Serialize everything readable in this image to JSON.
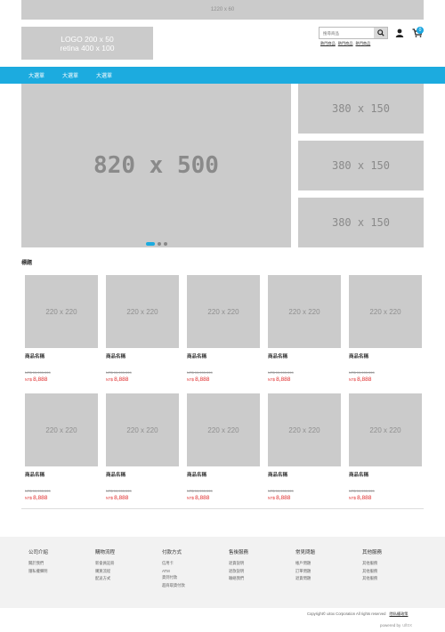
{
  "top_banner": "1220 x 60",
  "logo": {
    "line1": "LOGO 200 x 50",
    "line2": "retina 400 x 100"
  },
  "search": {
    "placeholder": "搜尋商品"
  },
  "hot_links": [
    "熱門商品",
    "熱門商品",
    "熱門商品"
  ],
  "cart_count": "0",
  "nav": [
    "大選單",
    "大選單",
    "大選單"
  ],
  "hero": "820 x 500",
  "side_banners": [
    "380 x 150",
    "380 x 150",
    "380 x 150"
  ],
  "section_title": "標題",
  "product_image_label": "220 x 220",
  "products": [
    {
      "name": "商品名稱",
      "original_price": "NT$ 99,999,999",
      "currency": "NT$",
      "price": "8,888"
    },
    {
      "name": "商品名稱",
      "original_price": "NT$ 99,999,999",
      "currency": "NT$",
      "price": "8,888"
    },
    {
      "name": "商品名稱",
      "original_price": "NT$ 99,999,999",
      "currency": "NT$",
      "price": "8,888"
    },
    {
      "name": "商品名稱",
      "original_price": "NT$ 99,999,999",
      "currency": "NT$",
      "price": "8,888"
    },
    {
      "name": "商品名稱",
      "original_price": "NT$ 99,999,999",
      "currency": "NT$",
      "price": "8,888"
    },
    {
      "name": "商品名稱",
      "original_price": "NT$ 99,999,999",
      "currency": "NT$",
      "price": "8,888"
    },
    {
      "name": "商品名稱",
      "original_price": "NT$ 99,999,999",
      "currency": "NT$",
      "price": "8,888"
    },
    {
      "name": "商品名稱",
      "original_price": "NT$ 99,999,999",
      "currency": "NT$",
      "price": "8,888"
    },
    {
      "name": "商品名稱",
      "original_price": "NT$ 99,999,999",
      "currency": "NT$",
      "price": "8,888"
    },
    {
      "name": "商品名稱",
      "original_price": "NT$ 99,999,999",
      "currency": "NT$",
      "price": "8,888"
    }
  ],
  "footer": [
    {
      "title": "公司介紹",
      "links": [
        "關於我們",
        "隱私權聲明"
      ]
    },
    {
      "title": "購物流程",
      "links": [
        "新會員註冊",
        "購買流程",
        "配送方式"
      ]
    },
    {
      "title": "付款方式",
      "links": [
        "信用卡",
        "ATM",
        "貨到付款",
        "超商取貨付款"
      ]
    },
    {
      "title": "售後服務",
      "links": [
        "退貨說明",
        "退款說明",
        "聯絡我們"
      ]
    },
    {
      "title": "常見問題",
      "links": [
        "帳戶問題",
        "訂單問題",
        "退貨問題"
      ]
    },
    {
      "title": "其他服務",
      "links": [
        "其他服務",
        "其他服務",
        "其他服務"
      ]
    }
  ],
  "copyright": "Copyright© uitox Corporation All rights reserved",
  "privacy_link": "隱私權政策",
  "powered_by": {
    "label": "powered by",
    "brand": "uitox"
  },
  "colors": {
    "accent": "#1cabdf",
    "price_red": "#e02b2b",
    "placeholder_gray": "#cbcbcb",
    "footer_bg": "#f2f2f2"
  }
}
